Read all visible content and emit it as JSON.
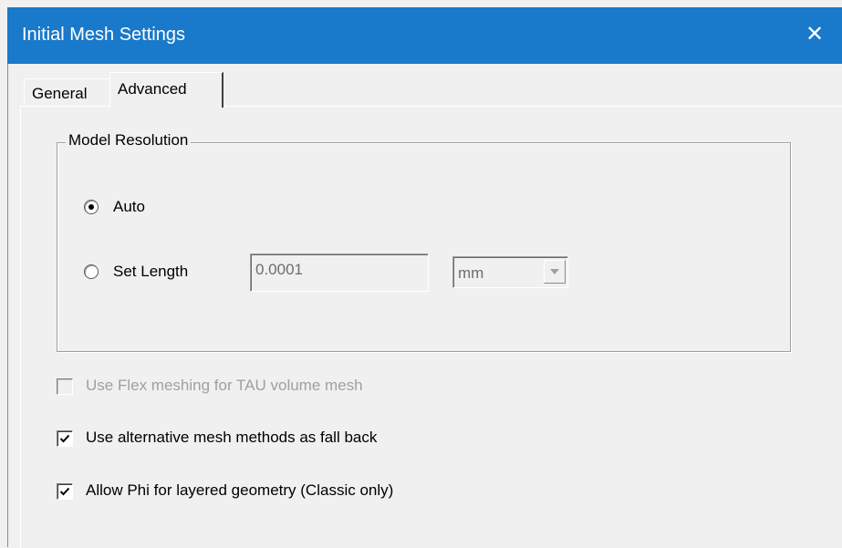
{
  "window": {
    "title": "Initial Mesh Settings",
    "close_glyph": "✕",
    "titlebar_color": "#1979ca"
  },
  "tabs": [
    {
      "label": "General",
      "selected": false
    },
    {
      "label": "Advanced",
      "selected": true
    }
  ],
  "model_resolution": {
    "legend": "Model Resolution",
    "auto": {
      "label": "Auto",
      "checked": true
    },
    "set_length": {
      "label": "Set Length",
      "checked": false
    },
    "length_value": "0.0001",
    "unit": "mm",
    "unit_dropdown_icon": "chevron-down-icon"
  },
  "options": {
    "flex_meshing": {
      "label": "Use Flex meshing for TAU volume mesh",
      "checked": false,
      "enabled": false
    },
    "alt_mesh": {
      "label": "Use alternative mesh methods as fall back",
      "checked": true,
      "enabled": true
    },
    "allow_phi": {
      "label": "Allow Phi for layered geometry (Classic only)",
      "checked": true,
      "enabled": true
    }
  }
}
